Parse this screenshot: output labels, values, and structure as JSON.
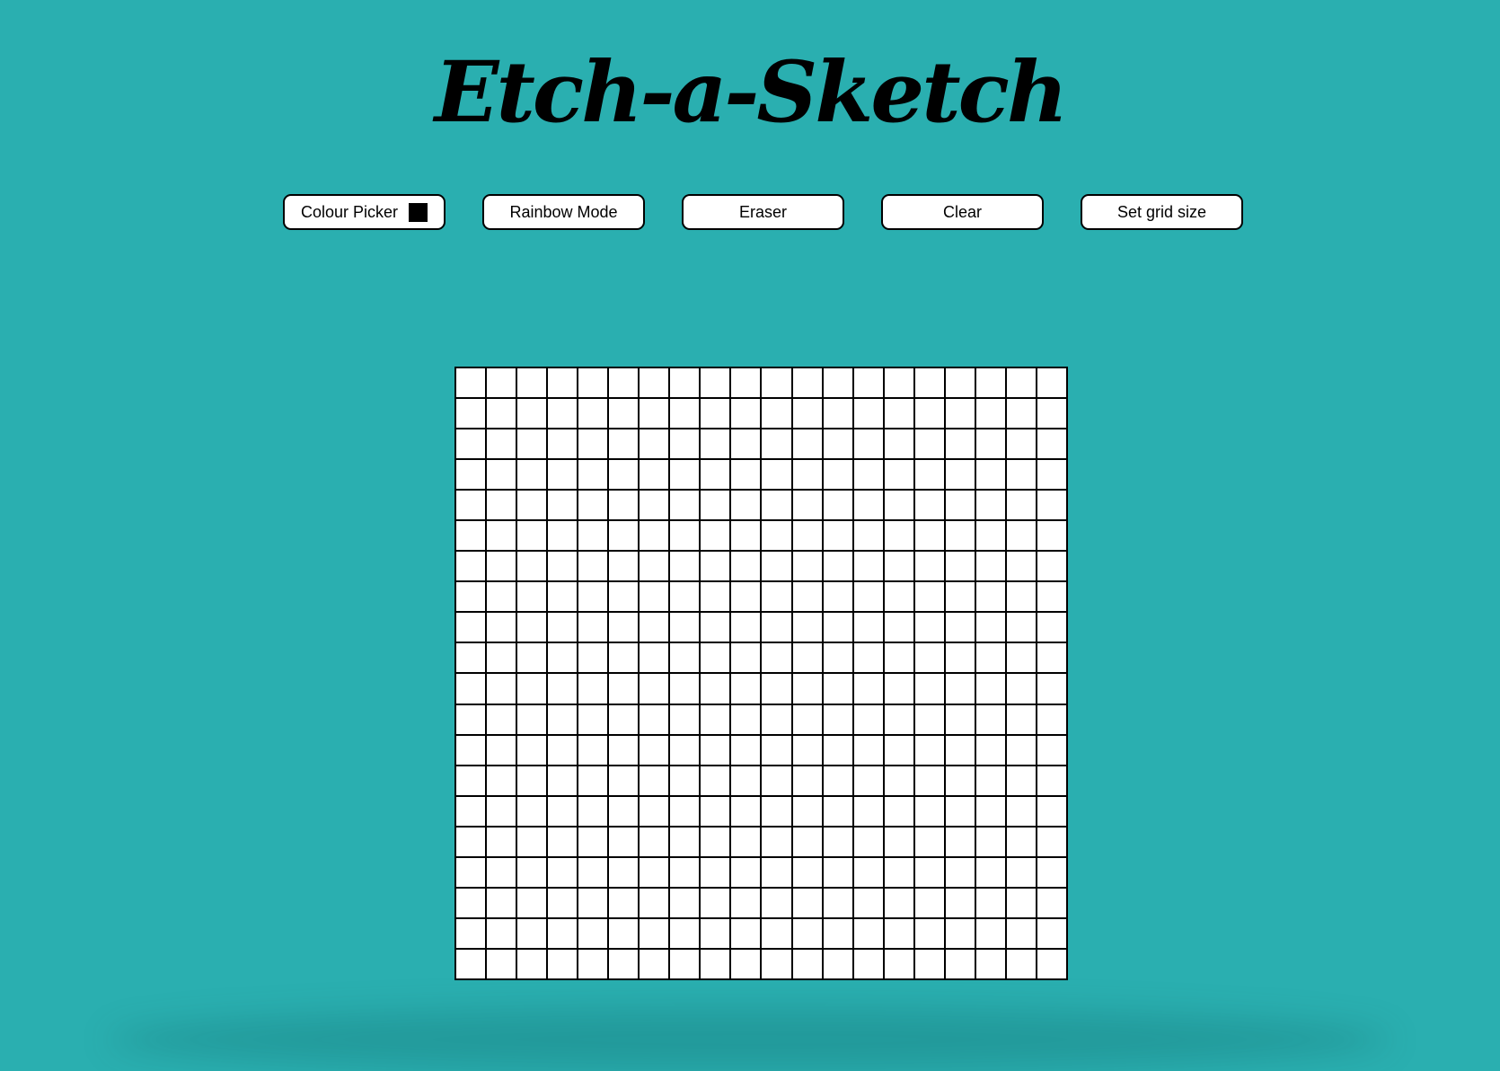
{
  "page": {
    "title": "Etch-a-Sketch",
    "background_color": "#2aafb0"
  },
  "toolbar": {
    "colour_picker_label": "Colour Picker",
    "colour_picker_value": "#000000",
    "rainbow_label": "Rainbow Mode",
    "eraser_label": "Eraser",
    "clear_label": "Clear",
    "grid_size_label": "Set grid size"
  },
  "grid": {
    "rows": 20,
    "columns": 20,
    "cell_color": "#ffffff",
    "line_color": "#000000"
  }
}
